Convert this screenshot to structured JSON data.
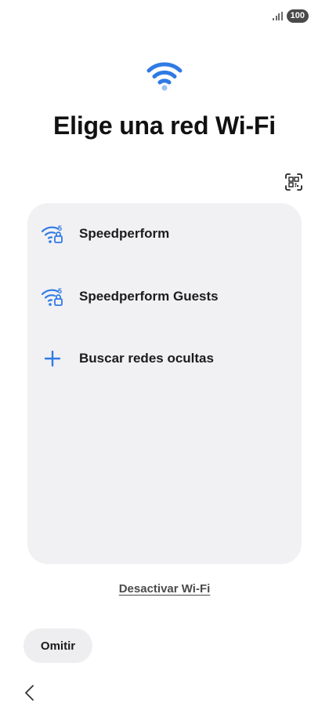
{
  "status_bar": {
    "signal_icon": "signal-bars-icon",
    "battery": "100"
  },
  "header": {
    "hero_icon": "wifi-icon",
    "title": "Elige una red Wi-Fi"
  },
  "qr_button": {
    "icon": "qr-scan-icon"
  },
  "networks": [
    {
      "name": "Speedperform",
      "icon": "wifi-6-lock-icon",
      "band_label": "5"
    },
    {
      "name": "Speedperform Guests",
      "icon": "wifi-6-lock-icon",
      "band_label": "5"
    }
  ],
  "hidden_networks": {
    "label": "Buscar redes ocultas",
    "icon": "plus-icon"
  },
  "disable_wifi": {
    "label": "Desactivar Wi-Fi"
  },
  "skip": {
    "label": "Omitir"
  },
  "nav": {
    "back_icon": "chevron-left-icon"
  },
  "colors": {
    "accent": "#2f7ae5",
    "card_bg": "#f1f1f4",
    "skip_bg": "#eeeef0"
  }
}
